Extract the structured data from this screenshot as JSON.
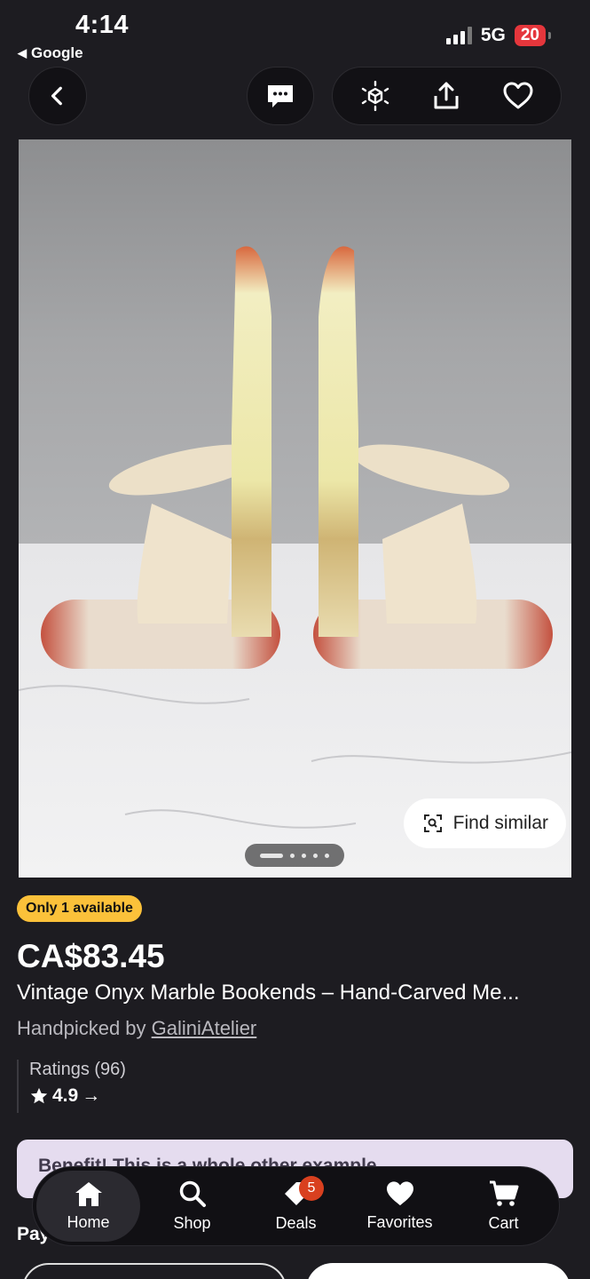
{
  "status": {
    "time": "4:14",
    "back_app": "Google",
    "network": "5G",
    "battery": "20"
  },
  "image": {
    "find_similar": "Find similar",
    "slide_count": 5,
    "active_slide": 1
  },
  "listing": {
    "badge": "Only 1 available",
    "price": "CA$83.45",
    "title": "Vintage Onyx Marble Bookends – Hand-Carved Me...",
    "picked_prefix": "Handpicked by ",
    "shop_name": "GaliniAtelier",
    "ratings_label": "Ratings (96)",
    "rating_value": "4.9",
    "rating_arrow": "→",
    "banner_text": "Benefit! This is a whole other example",
    "pay_label": "Pay"
  },
  "nav": {
    "home": "Home",
    "shop": "Shop",
    "deals": "Deals",
    "deals_badge": "5",
    "favorites": "Favorites",
    "cart": "Cart"
  },
  "colors": {
    "background": "#1d1c21",
    "badge": "#fbc13a",
    "battery": "#e5363c",
    "deals_badge": "#d9401f"
  },
  "icons": [
    "chevron-left-icon",
    "message-icon",
    "ar-cube-icon",
    "share-icon",
    "heart-icon",
    "scan-icon",
    "home-icon",
    "search-icon",
    "tag-icon",
    "heart-icon",
    "cart-icon",
    "star-icon"
  ]
}
